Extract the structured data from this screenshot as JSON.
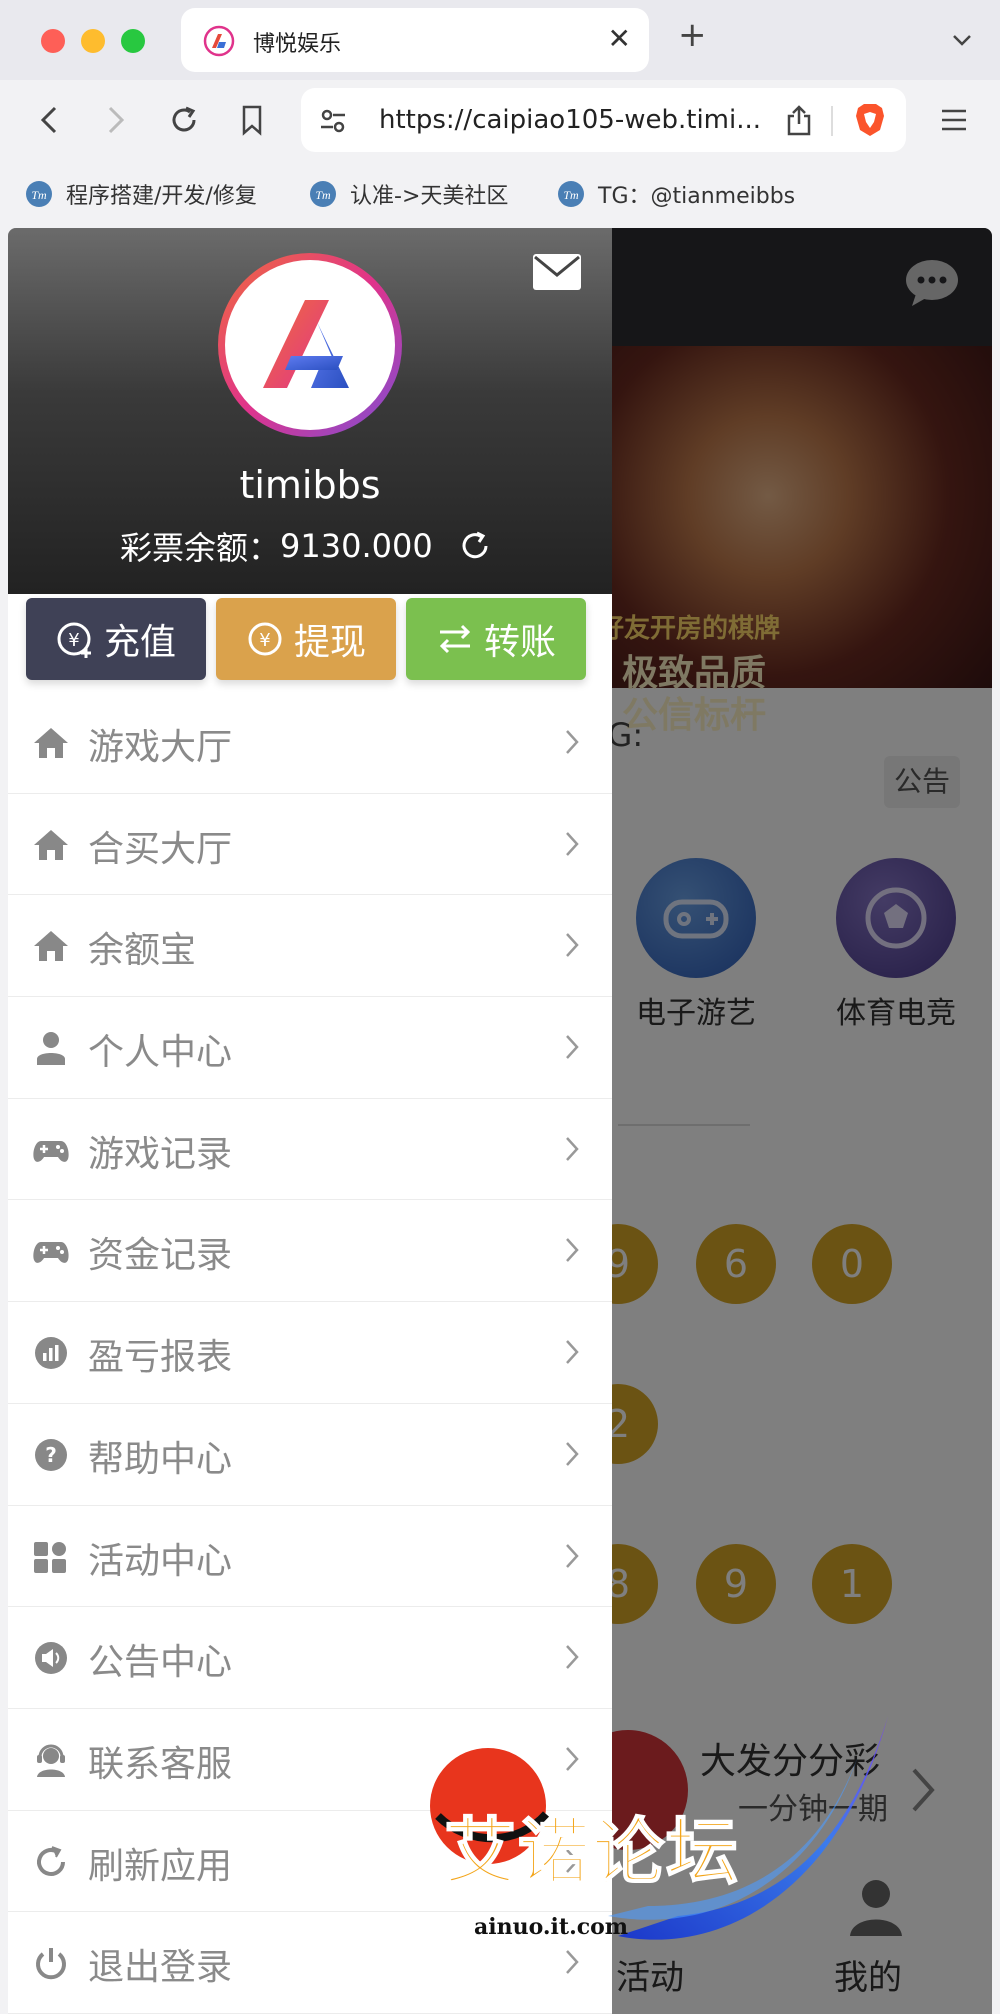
{
  "browser": {
    "tab_title": "博悦娱乐",
    "url": "https://caipiao105-web.timi...",
    "bookmarks": [
      {
        "label": "程序搭建/开发/修复"
      },
      {
        "label": "认准->天美社区"
      },
      {
        "label": "TG：@tianmeibbs"
      }
    ]
  },
  "drawer": {
    "username": "timibbs",
    "balance_label": "彩票余额：",
    "balance_value": "9130.000",
    "actions": {
      "deposit": "充值",
      "withdraw": "提现",
      "transfer": "转账"
    },
    "menu": [
      {
        "label": "游戏大厅",
        "icon": "home-icon"
      },
      {
        "label": "合买大厅",
        "icon": "home-icon"
      },
      {
        "label": "余额宝",
        "icon": "home-icon"
      },
      {
        "label": "个人中心",
        "icon": "user-icon"
      },
      {
        "label": "游戏记录",
        "icon": "gamepad-icon"
      },
      {
        "label": "资金记录",
        "icon": "gamepad-icon"
      },
      {
        "label": "盈亏报表",
        "icon": "chart-icon"
      },
      {
        "label": "帮助中心",
        "icon": "help-icon"
      },
      {
        "label": "活动中心",
        "icon": "apps-icon"
      },
      {
        "label": "公告中心",
        "icon": "speaker-icon"
      },
      {
        "label": "联系客服",
        "icon": "support-icon"
      },
      {
        "label": "刷新应用",
        "icon": "refresh-icon"
      },
      {
        "label": "退出登录",
        "icon": "power-icon"
      }
    ]
  },
  "background_page": {
    "banner_line1": "好友开房的棋牌",
    "banner_line2": "极致品质",
    "banner_line3": "公信标杆",
    "tg_text": "TG:",
    "notice_label": "公告",
    "categories": [
      "电子游艺",
      "体育电竞"
    ],
    "balls_row1": [
      "9",
      "6",
      "0"
    ],
    "balls_row2": [
      "2"
    ],
    "balls_row3": [
      "8",
      "9",
      "1"
    ],
    "lottery_name": "大发分分彩",
    "lottery_desc": "一分钟一期",
    "tab_activity": "活动",
    "tab_mine": "我的"
  },
  "watermark": {
    "text": "艾诺论坛",
    "domain": "ainuo.it.com"
  },
  "colors": {
    "deposit": "#3f4156",
    "withdraw": "#daa24c",
    "transfer": "#7bc04f",
    "ball": "#d6a727"
  }
}
